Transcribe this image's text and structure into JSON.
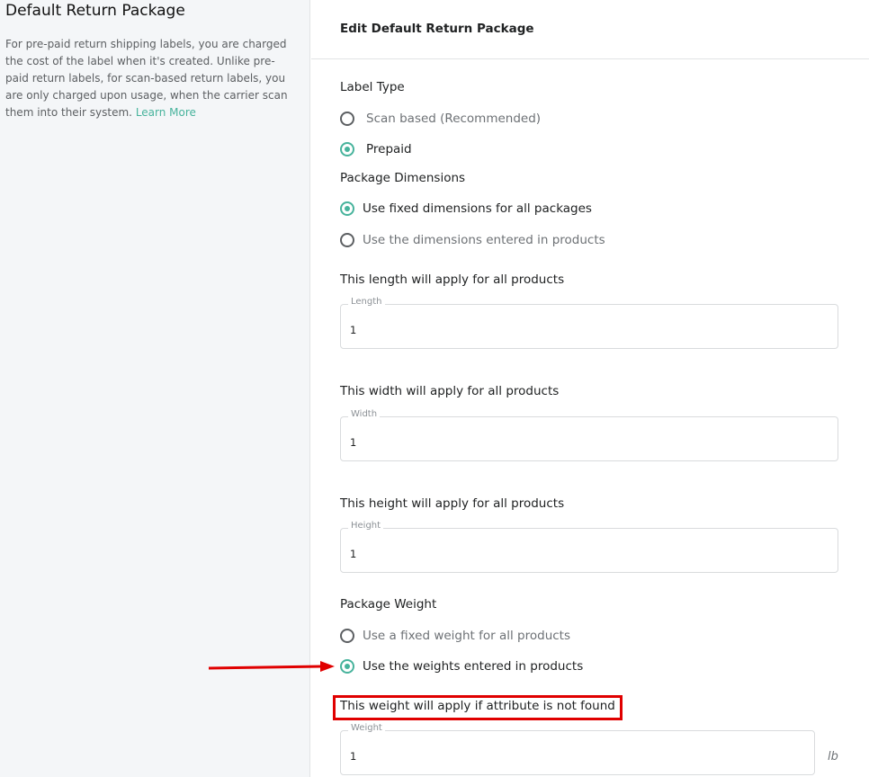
{
  "sidebar": {
    "title": "Default Return Package",
    "description": "For pre-paid return shipping labels, you are charged the cost of the label when it's created. Unlike pre-paid return labels, for scan-based return labels, you are only charged upon usage, when the carrier scan them into their system.",
    "learn_more": "Learn More"
  },
  "card": {
    "title": "Edit Default Return Package",
    "label_type": {
      "heading": "Label Type",
      "options": [
        "Scan based (Recommended)",
        "Prepaid"
      ],
      "selected": "Prepaid"
    },
    "package_dimensions": {
      "heading": "Package Dimensions",
      "options": [
        "Use fixed dimensions for all packages",
        "Use the dimensions entered in products"
      ],
      "selected": "Use fixed dimensions for all packages"
    },
    "length": {
      "heading": "This length will apply for all products",
      "label": "Length",
      "value": "1"
    },
    "width": {
      "heading": "This width will apply for all products",
      "label": "Width",
      "value": "1"
    },
    "height": {
      "heading": "This height will apply for all products",
      "label": "Height",
      "value": "1"
    },
    "package_weight": {
      "heading": "Package Weight",
      "options": [
        "Use a fixed weight for all products",
        "Use the weights entered in products"
      ],
      "selected": "Use the weights entered in products"
    },
    "weight": {
      "heading": "This weight will apply if attribute is not found",
      "label": "Weight",
      "value": "1",
      "unit": "lb"
    }
  },
  "colors": {
    "accent": "#47b39c",
    "annotation": "#e00000"
  },
  "icons": {
    "arrow": "red-arrow-icon"
  }
}
